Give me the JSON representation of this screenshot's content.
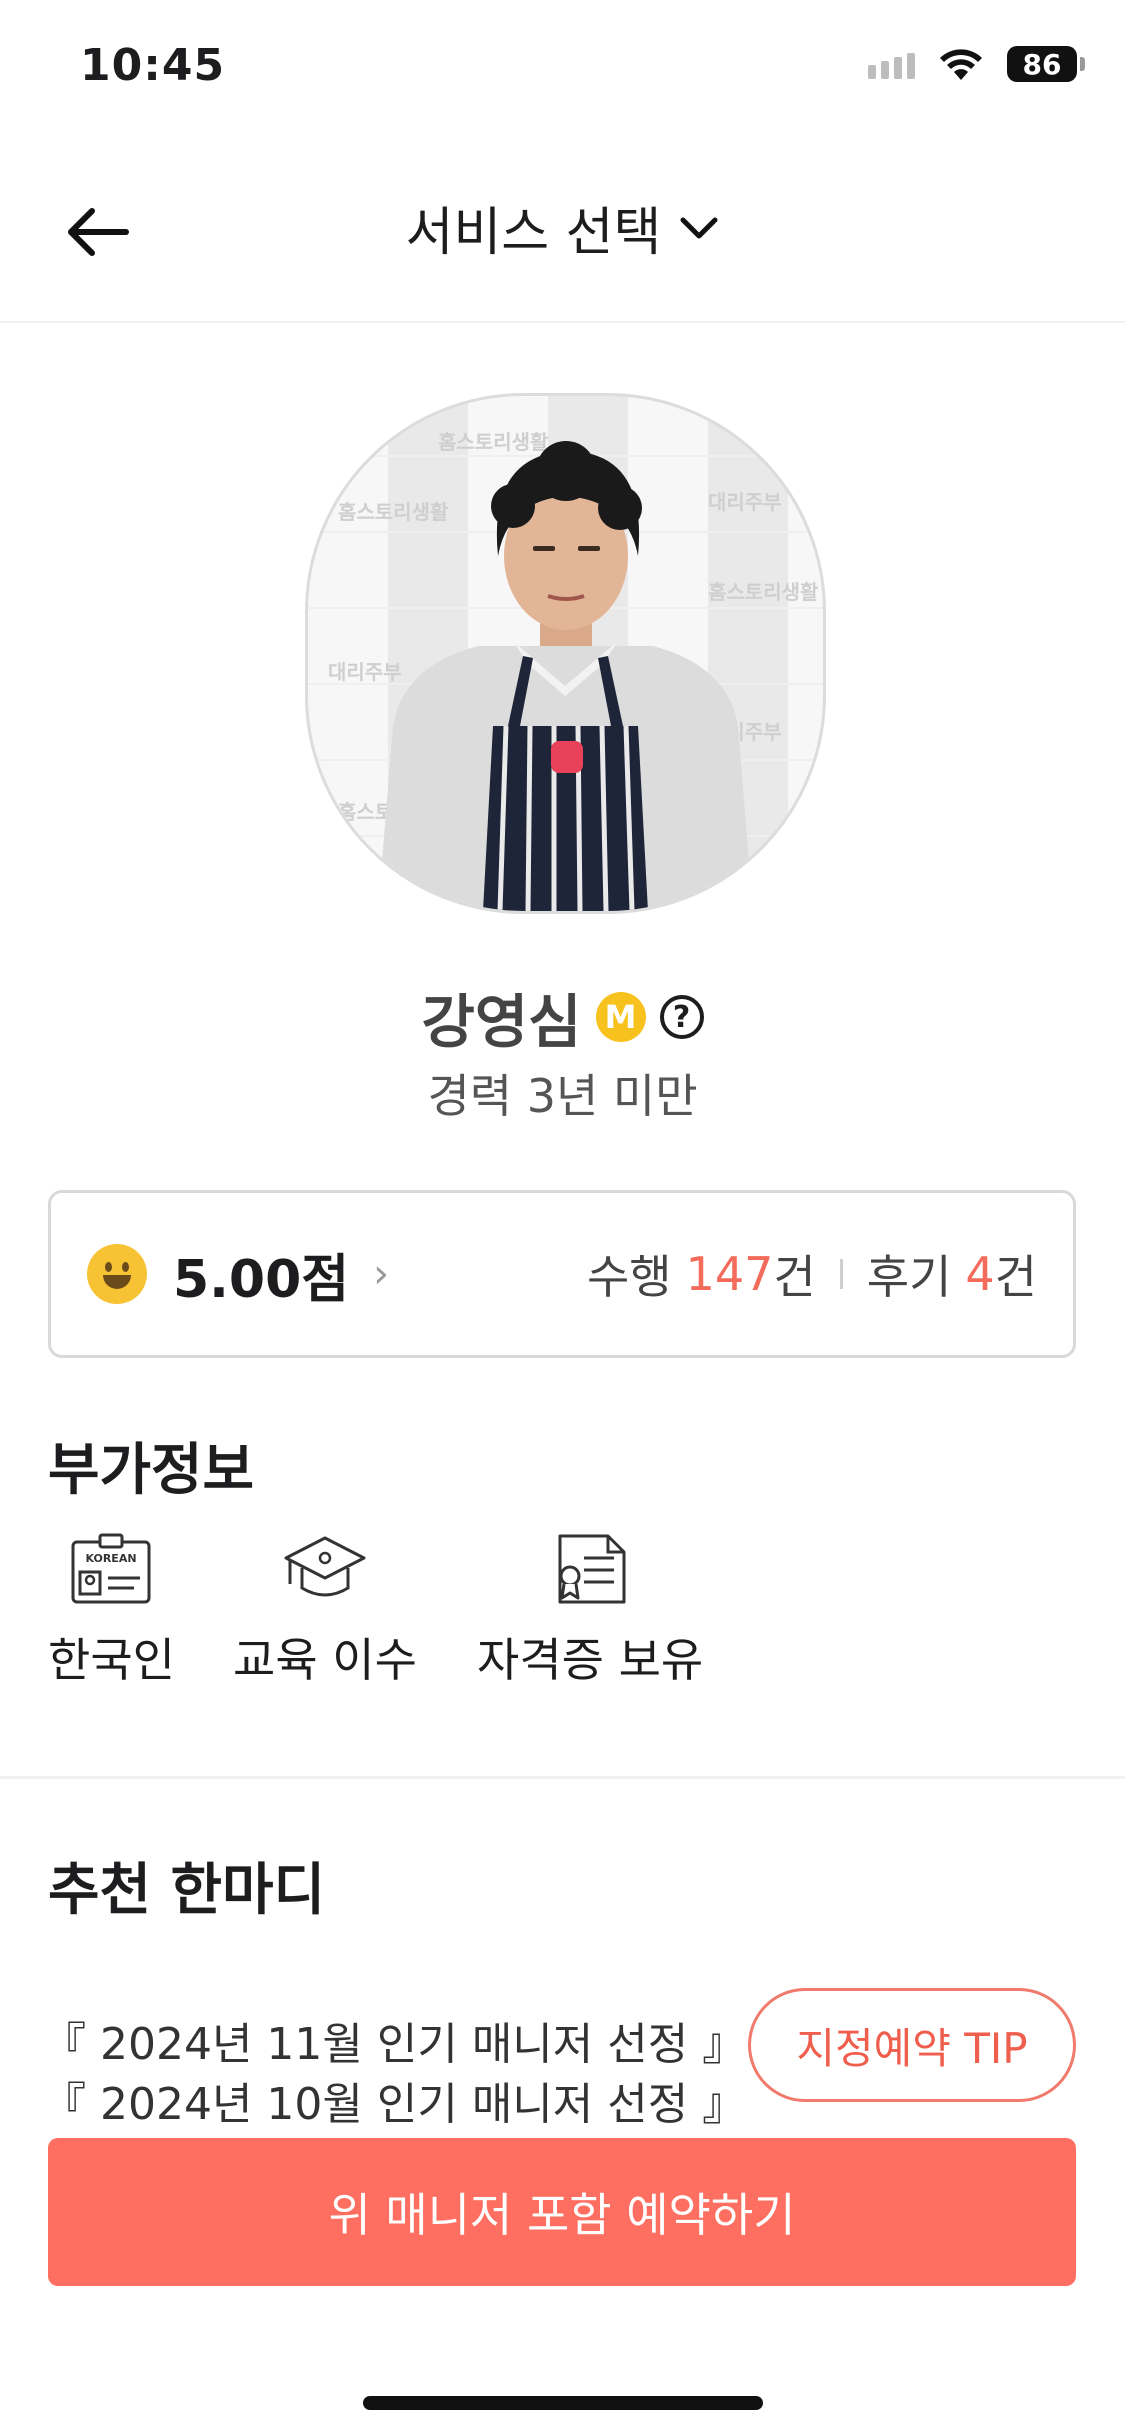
{
  "status_bar": {
    "time": "10:45",
    "battery": "86"
  },
  "header": {
    "title": "서비스 선택"
  },
  "profile": {
    "name": "강영심",
    "grade_badge": "M",
    "help_symbol": "?",
    "career": "경력 3년 미만",
    "photo_backdrop_texts": [
      "홈스토리생활",
      "대리주부"
    ]
  },
  "rating": {
    "score": "5.00점",
    "performed_label": "수행",
    "performed_count": "147",
    "review_label": "후기",
    "review_count": "4",
    "unit": "건"
  },
  "extra_info": {
    "title": "부가정보",
    "korean_badge_text": "KOREAN",
    "items": [
      {
        "label": "한국인",
        "icon": "korean-id-card-icon"
      },
      {
        "label": "교육 이수",
        "icon": "graduation-cap-icon"
      },
      {
        "label": "자격증 보유",
        "icon": "certificate-icon"
      }
    ]
  },
  "recommendation": {
    "title": "추천 한마디",
    "lines": [
      "『 2024년 11월 인기 매니저 선정 』",
      "『 2024년 10월 인기 매니저 선정 』"
    ],
    "tip_button": "지정예약 TIP"
  },
  "cta": {
    "label": "위 매니저 포함 예약하기"
  },
  "colors": {
    "accent": "#ff6f61",
    "highlight": "#f26b5b",
    "badge": "#f7c21e"
  }
}
